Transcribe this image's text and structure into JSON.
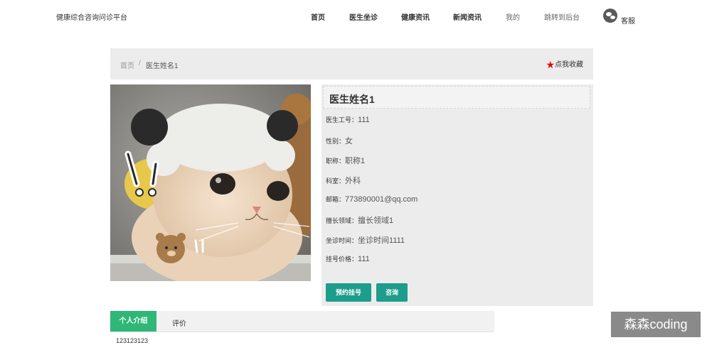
{
  "header": {
    "brand": "健康综合咨询问诊平台",
    "nav": [
      {
        "label": "首页"
      },
      {
        "label": "医生坐诊"
      },
      {
        "label": "健康资讯"
      },
      {
        "label": "新闻资讯"
      },
      {
        "label": "我的"
      },
      {
        "label": "跳转到后台"
      }
    ],
    "service_label": "客服"
  },
  "breadcrumb": {
    "home": "首页",
    "separator": "/",
    "current": "医生姓名1",
    "favorite": "点我收藏"
  },
  "doctor": {
    "name": "医生姓名1",
    "fields": [
      {
        "label": "医生工号：",
        "value": "111"
      },
      {
        "label": "性别：",
        "value": "女"
      },
      {
        "label": "职称：",
        "value": "职称1"
      },
      {
        "label": "科室：",
        "value": "外科"
      },
      {
        "label": "邮箱：",
        "value": "773890001@qq.com"
      },
      {
        "label": "擅长领域：",
        "value": "擅长领域1"
      },
      {
        "label": "坐诊时间：",
        "value": "坐诊时间1111"
      },
      {
        "label": "挂号价格：",
        "value": "111"
      }
    ],
    "actions": {
      "book": "预约挂号",
      "consult": "咨询"
    }
  },
  "tabs": {
    "items": [
      {
        "label": "个人介绍"
      },
      {
        "label": "评价"
      }
    ],
    "active": "个人介绍"
  },
  "intro_text": "123123123",
  "watermark": "森森coding",
  "colors": {
    "accent_teal": "#1d9d8c",
    "tab_green": "#2fb777",
    "panel_gray": "#ececec",
    "star_red": "#e60012"
  }
}
